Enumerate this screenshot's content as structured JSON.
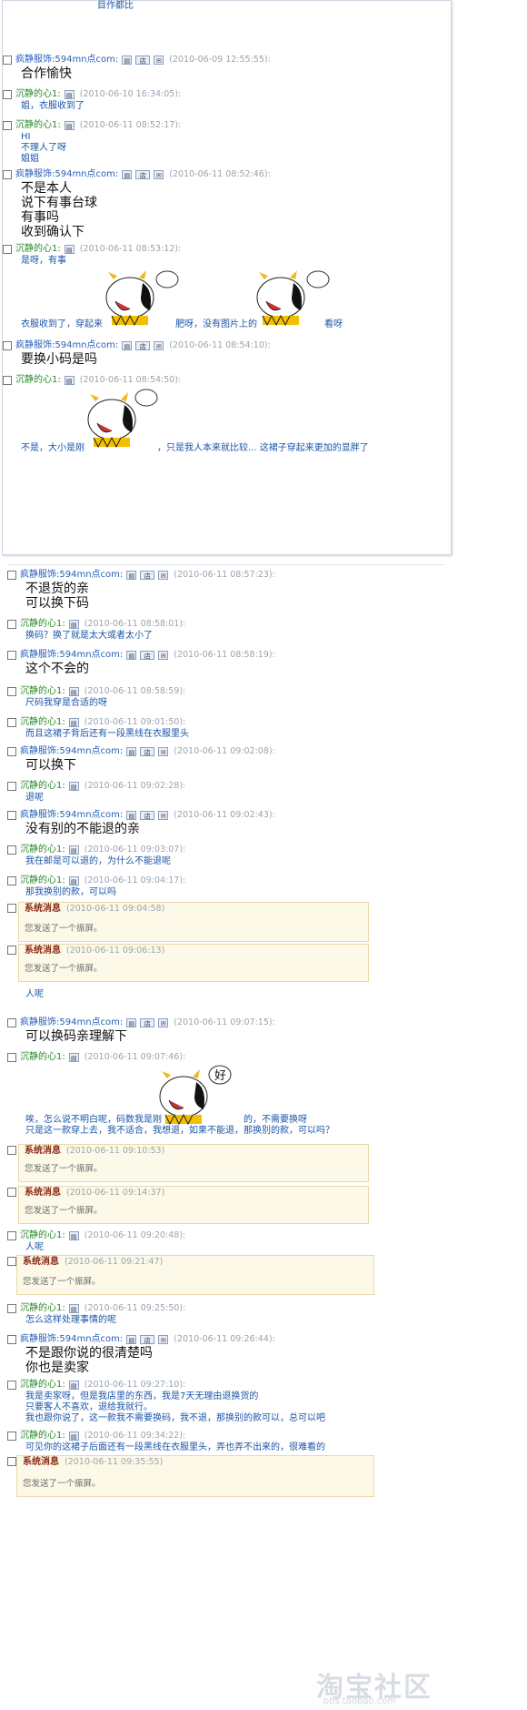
{
  "window": {
    "top_partial_text": "目作都比"
  },
  "colors": {
    "seller": "#2a5fb8",
    "buyer": "#2b8a2b",
    "timestamp": "#9aa4b0",
    "system_bg": "#fdf9e8"
  },
  "names": {
    "seller": "疯静服饰:594mn点com:",
    "buyer": "沉静的心1:",
    "system": "系统消息"
  },
  "icons": [
    "profile-icon",
    "shop-icon",
    "contact-icon"
  ],
  "messages": [
    {
      "name": "疯静服饰:594mn点com:",
      "time": "(2010-06-09 12:55:55):",
      "text": "合作愉快"
    },
    {
      "name": "沉静的心1:",
      "time": "(2010-06-10 16:34:05):",
      "text": "姐，衣服收到了"
    },
    {
      "name": "沉静的心1:",
      "time": "(2010-06-11 08:52:17):",
      "text": "HI\n不理人了呀\n姐姐"
    },
    {
      "name": "疯静服饰:594mn点com:",
      "time": "(2010-06-11 08:52:46):",
      "text": "不是本人\n说下有事台球\n有事吗\n收到确认下"
    },
    {
      "name": "沉静的心1:",
      "time": "(2010-06-11 08:53:12):",
      "text": "是呀，有事",
      "line2a": "衣服收到了，穿起来",
      "line2b": "肥呀，没有图片上的",
      "line2c": "看呀"
    },
    {
      "name": "疯静服饰:594mn点com:",
      "time": "(2010-06-11 08:54:10):",
      "text": "要换小码是吗"
    },
    {
      "name": "沉静的心1:",
      "time": "(2010-06-11 08:54:50):",
      "line_a": "不是，大小是刚",
      "line_b": "，只是我人本来就比较... 这裙子穿起来更加的显胖了"
    },
    {
      "name": "疯静服饰:594mn点com:",
      "time": "(2010-06-11 08:57:23):",
      "text": "不退货的亲\n可以换下码"
    },
    {
      "name": "沉静的心1:",
      "time": "(2010-06-11 08:58:01):",
      "text": "换码？换了就是太大或者太小了"
    },
    {
      "name": "疯静服饰:594mn点com:",
      "time": "(2010-06-11 08:58:19):",
      "text": "这个不会的"
    },
    {
      "name": "沉静的心1:",
      "time": "(2010-06-11 08:58:59):",
      "text": "尺码我穿是合适的呀"
    },
    {
      "name": "沉静的心1:",
      "time": "(2010-06-11 09:01:50):",
      "text": "而且这裙子背后还有一段黑线在衣服里头"
    },
    {
      "name": "疯静服饰:594mn点com:",
      "time": "(2010-06-11 09:02:08):",
      "text": "可以换下"
    },
    {
      "name": "沉静的心1:",
      "time": "(2010-06-11 09:02:28):",
      "text": "退呢"
    },
    {
      "name": "疯静服饰:594mn点com:",
      "time": "(2010-06-11 09:02:43):",
      "text": "没有别的不能退的亲"
    },
    {
      "name": "沉静的心1:",
      "time": "(2010-06-11 09:03:07):",
      "text": "我在邮是可以退的，为什么不能退呢"
    },
    {
      "name": "沉静的心1:",
      "time": "(2010-06-11 09:04:17):",
      "text": "那我换别的款，可以吗"
    },
    {
      "name": "系统消息",
      "time": "(2010-06-11 09:04:58)",
      "text": "您发送了一个振屏。"
    },
    {
      "name": "系统消息",
      "time": "(2010-06-11 09:06:13)",
      "text": "您发送了一个振屏。"
    },
    {
      "name": "",
      "time": "",
      "text": "人呢"
    },
    {
      "name": "疯静服饰:594mn点com:",
      "time": "(2010-06-11 09:07:15):",
      "text": "可以换码亲理解下"
    },
    {
      "name": "沉静的心1:",
      "time": "(2010-06-11 09:07:46):",
      "line_a": "唉，怎么说不明白呢，码数我是刚",
      "line_b": "的，不需要换呀",
      "line_c": "只是这一款穿上去，我不适合，我想退，如果不能退，那换别的款，可以吗？",
      "bubble": "好"
    },
    {
      "name": "系统消息",
      "time": "(2010-06-11 09:10:53)",
      "text": "您发送了一个振屏。"
    },
    {
      "name": "系统消息",
      "time": "(2010-06-11 09:14:37)",
      "text": "您发送了一个振屏。"
    },
    {
      "name": "沉静的心1:",
      "time": "(2010-06-11 09:20:48):",
      "text": "人呢"
    },
    {
      "name": "系统消息",
      "time": "(2010-06-11 09:21:47)",
      "text": "您发送了一个振屏。"
    },
    {
      "name": "沉静的心1:",
      "time": "(2010-06-11 09:25:50):",
      "text": "怎么这样处理事情的呢"
    },
    {
      "name": "疯静服饰:594mn点com:",
      "time": "(2010-06-11 09:26:44):",
      "text": "不是跟你说的很清楚吗\n你也是卖家"
    },
    {
      "name": "沉静的心1:",
      "time": "(2010-06-11 09:27:10):",
      "text": "我是卖家呀，但是我店里的东西，我是7天无理由退换货的\n只要客人不喜欢，退给我就行。\n我也跟你说了，这一款我不需要换码，我不退，那换别的款可以，总可以吧"
    },
    {
      "name": "沉静的心1:",
      "time": "(2010-06-11 09:34:22):",
      "text": "可见你的这裙子后面还有一段黑线在衣服里头，弄也弄不出来的，很难看的"
    },
    {
      "name": "系统消息",
      "time": "(2010-06-11 09:35:55)",
      "text": "您发送了一个振屏。"
    }
  ],
  "watermark": {
    "main": "淘宝社区",
    "sub": "bbs.taobao.com"
  }
}
